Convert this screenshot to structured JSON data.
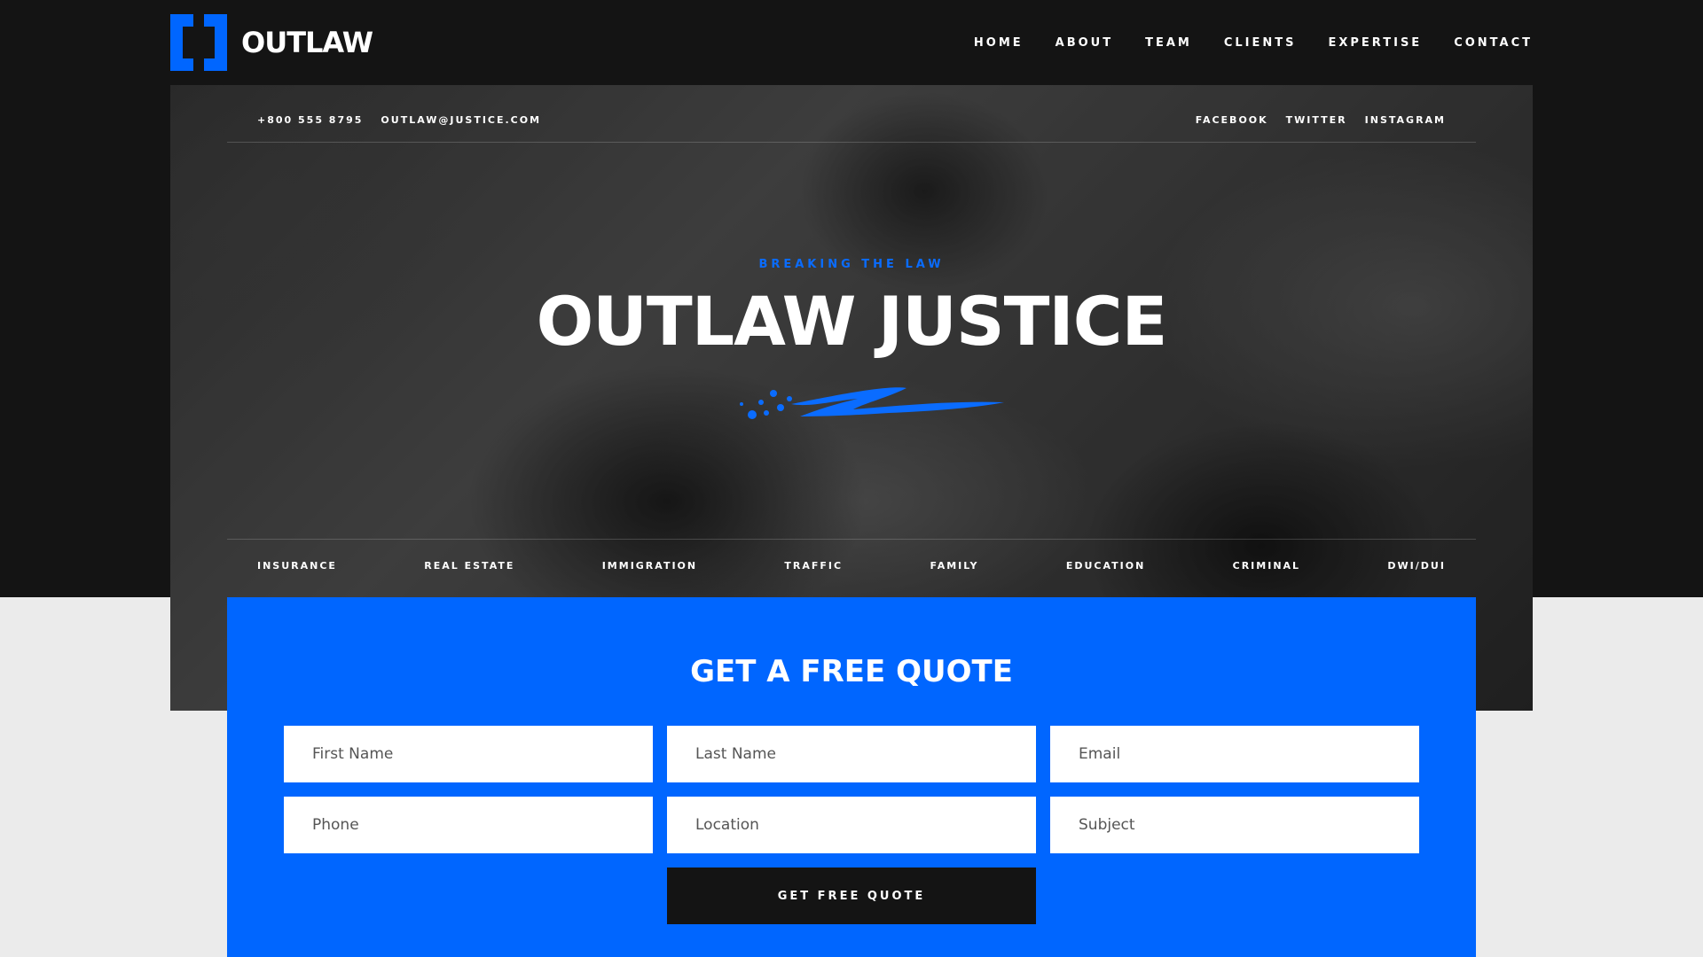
{
  "brand": {
    "name": "OUTLAW",
    "accent": "#0066ff",
    "dark": "#141414"
  },
  "nav": [
    "HOME",
    "ABOUT",
    "TEAM",
    "CLIENTS",
    "EXPERTISE",
    "CONTACT"
  ],
  "topbar": {
    "phone": "+800 555 8795",
    "email": "OUTLAW@JUSTICE.COM",
    "social": [
      "FACEBOOK",
      "TWITTER",
      "INSTAGRAM"
    ]
  },
  "hero": {
    "kicker": "BREAKING THE LAW",
    "title": "OUTLAW JUSTICE"
  },
  "practice_areas": [
    "INSURANCE",
    "REAL ESTATE",
    "IMMIGRATION",
    "TRAFFIC",
    "FAMILY",
    "EDUCATION",
    "CRIMINAL",
    "DWI/DUI"
  ],
  "quote": {
    "title": "GET A FREE QUOTE",
    "fields": {
      "first_name": "First Name",
      "last_name": "Last Name",
      "email": "Email",
      "phone": "Phone",
      "location": "Location",
      "subject": "Subject"
    },
    "submit": "GET FREE QUOTE"
  }
}
